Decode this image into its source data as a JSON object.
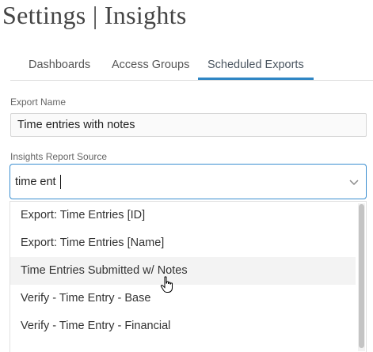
{
  "page": {
    "title": "Settings | Insights"
  },
  "tabs": [
    {
      "label": "Dashboards",
      "active": false
    },
    {
      "label": "Access Groups",
      "active": false
    },
    {
      "label": "Scheduled Exports",
      "active": true
    }
  ],
  "export_name": {
    "label": "Export Name",
    "value": "Time entries with notes"
  },
  "report_source": {
    "label": "Insights Report Source",
    "search_value": "time ent",
    "options": [
      {
        "label": "Export: Time Entries [ID]",
        "highlighted": false
      },
      {
        "label": "Export: Time Entries [Name]",
        "highlighted": false
      },
      {
        "label": "Time Entries Submitted w/ Notes",
        "highlighted": true
      },
      {
        "label": "Verify - Time Entry - Base",
        "highlighted": false
      },
      {
        "label": "Verify - Time Entry - Financial",
        "highlighted": false
      }
    ]
  },
  "icons": {
    "dropdown": "chevron-down-icon",
    "pointer": "hand-pointer-icon"
  },
  "colors": {
    "accent": "#2f86c4",
    "focus_border": "#3a8ed0",
    "option_hover": "#f3f3f3"
  }
}
